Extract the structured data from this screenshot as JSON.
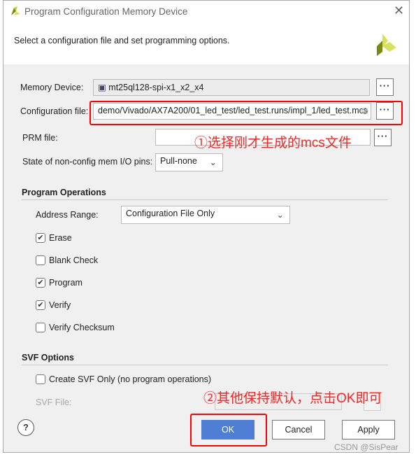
{
  "window": {
    "title": "Program Configuration Memory Device",
    "close_icon": "close-icon"
  },
  "intro": "Select a configuration file and set programming options.",
  "memory_device": {
    "label": "Memory Device:",
    "value": "mt25ql128-spi-x1_x2_x4",
    "browse": "···"
  },
  "config_file": {
    "label": "Configuration file:",
    "value": "demo/Vivado/AX7A200/01_led_test/led_test.runs/impl_1/led_test.mcs",
    "browse": "···"
  },
  "prm_file": {
    "label": "PRM file:",
    "value": "",
    "browse": "···"
  },
  "pin_state": {
    "label": "State of non-config mem I/O pins:",
    "value": "Pull-none"
  },
  "program_operations": {
    "title": "Program Operations",
    "address_range_label": "Address Range:",
    "address_range_value": "Configuration File Only",
    "options": [
      {
        "label": "Erase",
        "checked": true
      },
      {
        "label": "Blank Check",
        "checked": false
      },
      {
        "label": "Program",
        "checked": true
      },
      {
        "label": "Verify",
        "checked": true
      },
      {
        "label": "Verify Checksum",
        "checked": false
      }
    ]
  },
  "svf_options": {
    "title": "SVF Options",
    "create_svf_label": "Create SVF Only (no program operations)",
    "create_svf_checked": false,
    "svf_file_label": "SVF File:",
    "browse": "···"
  },
  "buttons": {
    "help": "?",
    "ok": "OK",
    "cancel": "Cancel",
    "apply": "Apply"
  },
  "annotations": {
    "step1": "①选择刚才生成的mcs文件",
    "step2": "②其他保持默认，点击OK即可"
  },
  "watermark": "CSDN @SisPear",
  "colors": {
    "ok_button": "#4f7fd4",
    "annotation": "#ff0000",
    "logo_dark": "#7a8a10",
    "logo_light": "#d8e060"
  }
}
